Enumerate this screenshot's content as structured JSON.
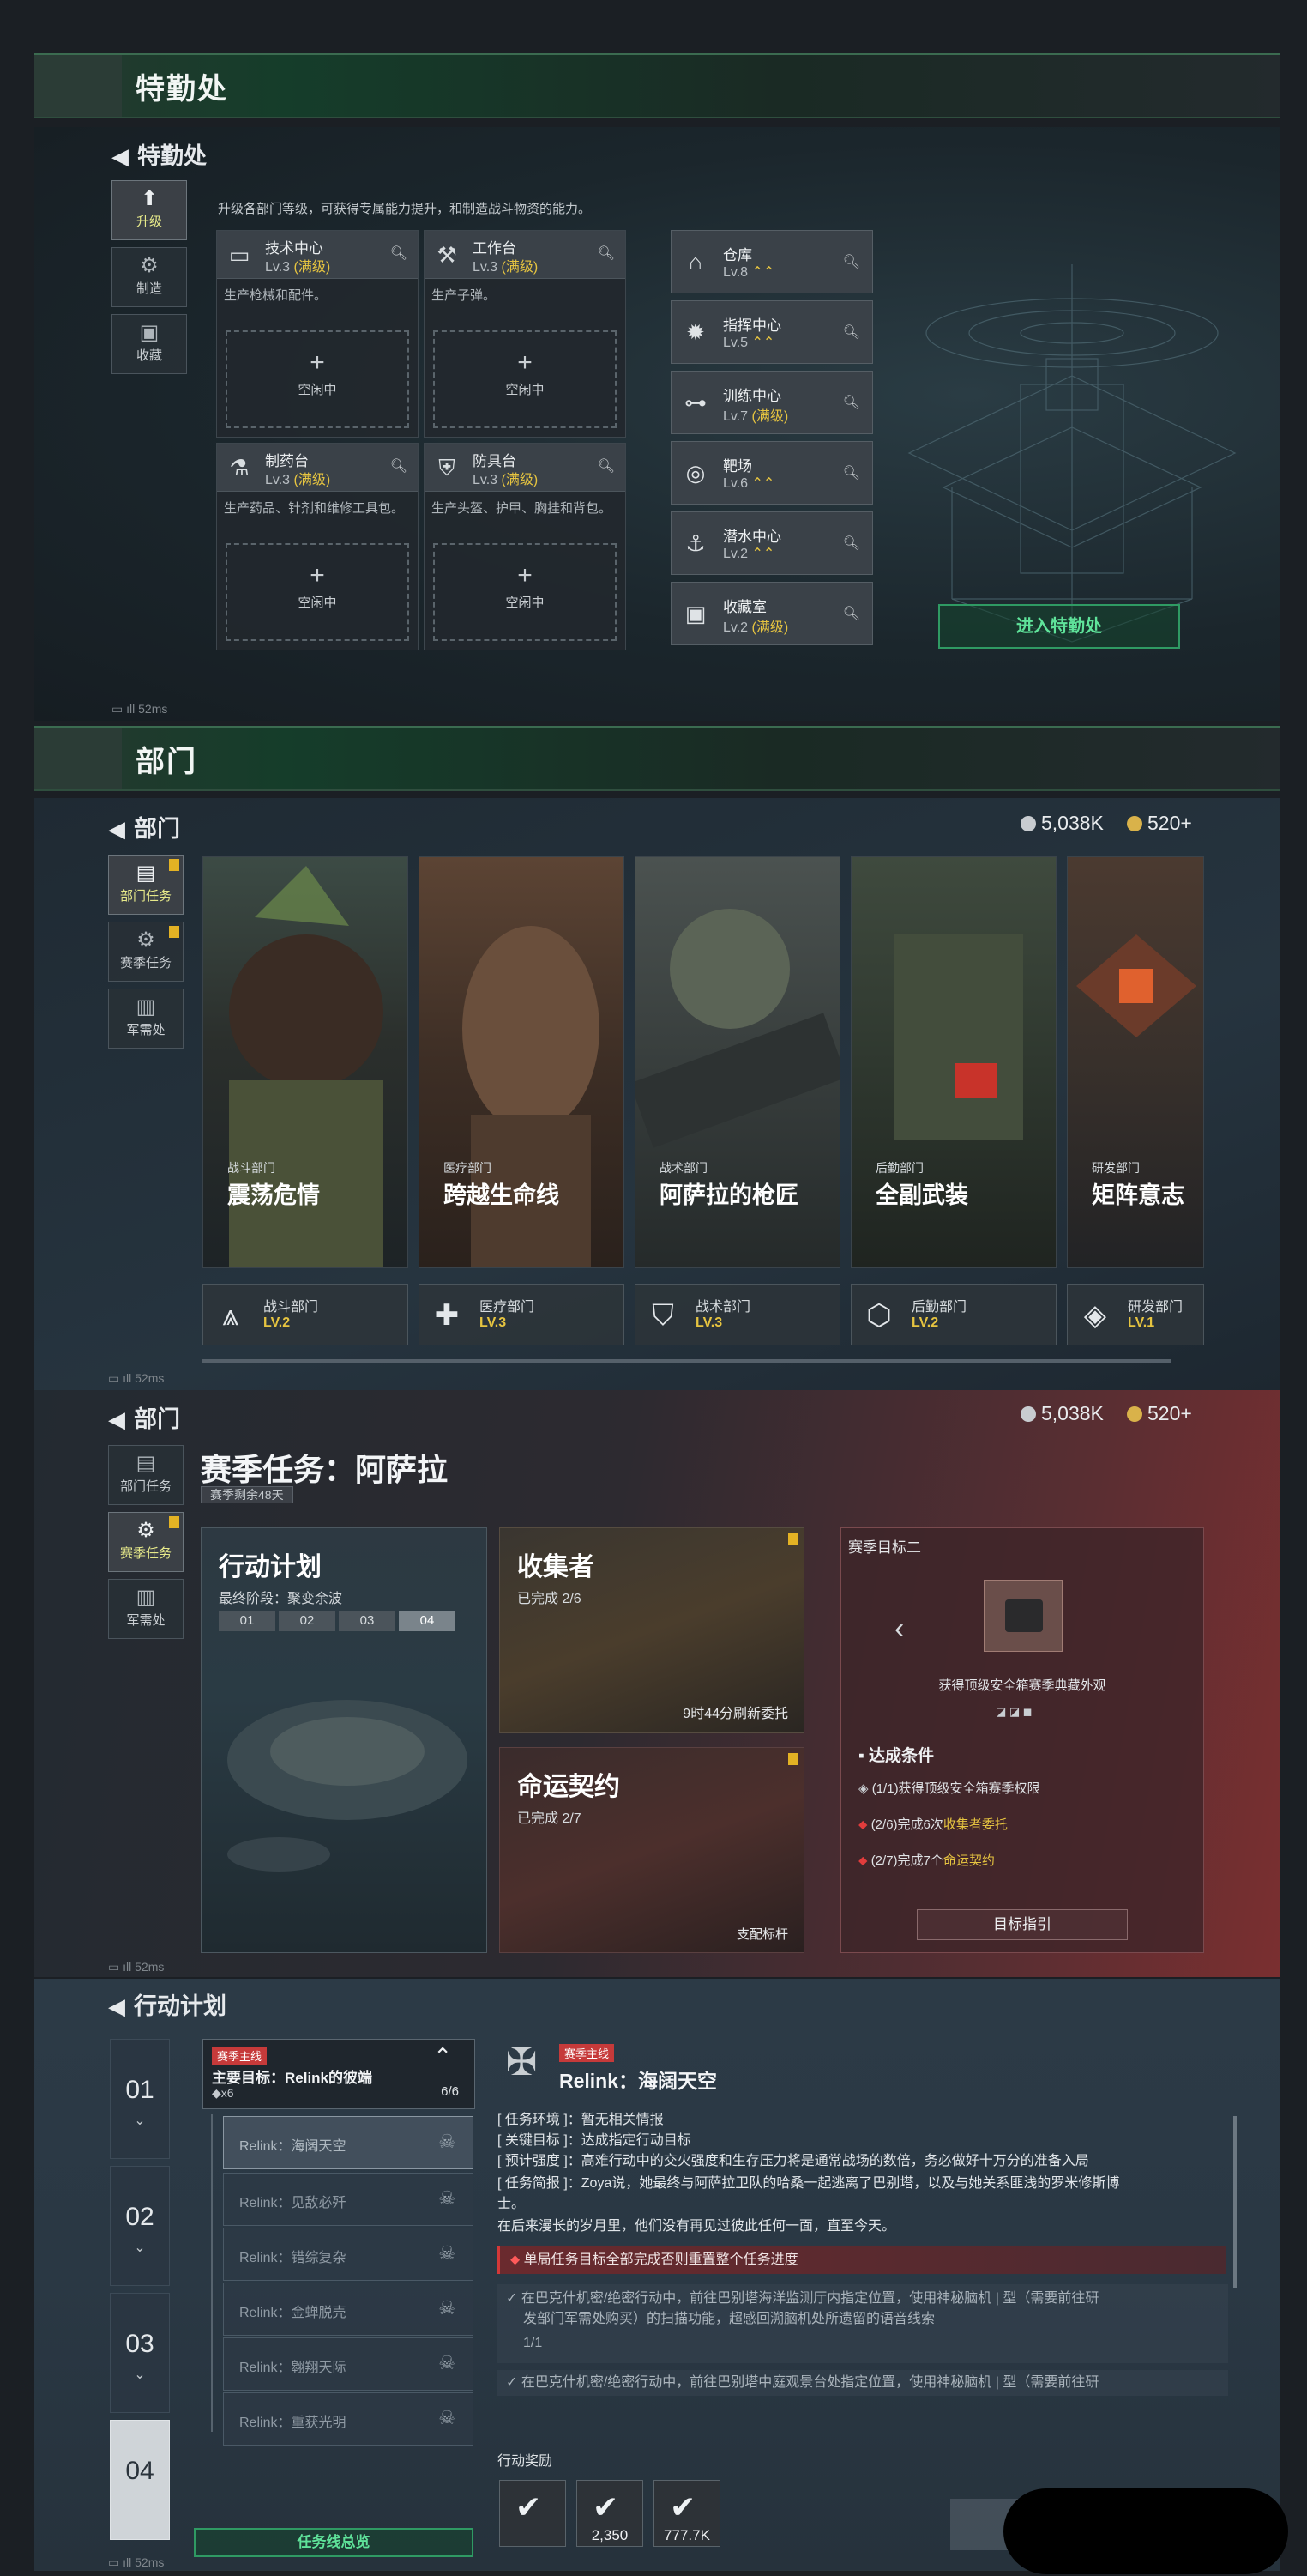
{
  "section1": {
    "banner": "特勤处",
    "back": "特勤处",
    "tabs": [
      "升级",
      "制造",
      "收藏"
    ],
    "description": "升级各部门等级，可获得专属能力提升，和制造战斗物资的能力。",
    "cards": [
      {
        "name": "技术中心",
        "level": "Lv.3",
        "max": "(满级)",
        "desc": "生产枪械和配件。",
        "slot": "空闲中"
      },
      {
        "name": "工作台",
        "level": "Lv.3",
        "max": "(满级)",
        "desc": "生产子弹。",
        "slot": "空闲中"
      },
      {
        "name": "制药台",
        "level": "Lv.3",
        "max": "(满级)",
        "desc": "生产药品、针剂和维修工具包。",
        "slot": "空闲中"
      },
      {
        "name": "防具台",
        "level": "Lv.3",
        "max": "(满级)",
        "desc": "生产头盔、护甲、胸挂和背包。",
        "slot": "空闲中"
      }
    ],
    "facilities": [
      {
        "name": "仓库",
        "level": "Lv.8",
        "suffix": "⌃⌃"
      },
      {
        "name": "指挥中心",
        "level": "Lv.5",
        "suffix": "⌃⌃"
      },
      {
        "name": "训练中心",
        "level": "Lv.7",
        "suffix": "(满级)"
      },
      {
        "name": "靶场",
        "level": "Lv.6",
        "suffix": "⌃⌃"
      },
      {
        "name": "潜水中心",
        "level": "Lv.2",
        "suffix": "⌃⌃"
      },
      {
        "name": "收藏室",
        "level": "Lv.2",
        "suffix": "(满级)"
      }
    ],
    "enter_button": "进入特勤处",
    "ping": "52ms"
  },
  "section2": {
    "banner": "部门",
    "back": "部门",
    "coins": "5,038K",
    "tickets": "520+",
    "tabs": [
      "部门任务",
      "赛季任务",
      "军需处"
    ],
    "departments": [
      {
        "sub": "战斗部门",
        "title": "震荡危情",
        "dept": "战斗部门",
        "level": "LV.2"
      },
      {
        "sub": "医疗部门",
        "title": "跨越生命线",
        "dept": "医疗部门",
        "level": "LV.3"
      },
      {
        "sub": "战术部门",
        "title": "阿萨拉的枪匠",
        "dept": "战术部门",
        "level": "LV.3"
      },
      {
        "sub": "后勤部门",
        "title": "全副武装",
        "dept": "后勤部门",
        "level": "LV.2"
      },
      {
        "sub": "研发部门",
        "title": "矩阵意志",
        "dept": "研发部门",
        "level": "LV.1"
      }
    ],
    "ping": "52ms"
  },
  "section3": {
    "back": "部门",
    "coins": "5,038K",
    "tickets": "520+",
    "tabs": [
      "部门任务",
      "赛季任务",
      "军需处"
    ],
    "title": "赛季任务：阿萨拉",
    "remaining": "赛季剩余48天",
    "plan": {
      "title": "行动计划",
      "stage_label": "最终阶段：聚变余波",
      "steps": [
        "01",
        "02",
        "03",
        "04"
      ]
    },
    "collector": {
      "title": "收集者",
      "progress": "已完成 2/6",
      "refresh": "9时44分刷新委托"
    },
    "fate": {
      "title": "命运契约",
      "progress": "已完成 2/7",
      "tag": "支配标杆"
    },
    "goal": {
      "header": "赛季目标二",
      "reward": "获得顶级安全箱赛季典藏外观",
      "cond_title": "达成条件",
      "conditions": [
        {
          "pre": "(1/1)获得顶级安全箱赛季权限",
          "hl": ""
        },
        {
          "pre": "(2/6)完成6次",
          "hl": "收集者委托"
        },
        {
          "pre": "(2/7)完成7个",
          "hl": "命运契约"
        }
      ],
      "button": "目标指引"
    },
    "ping": "52ms"
  },
  "section4": {
    "back": "行动计划",
    "rows": [
      "01",
      "02",
      "03",
      "04"
    ],
    "main_tag": "赛季主线",
    "main_goal": "主要目标：Relink的彼端",
    "main_count": "◆x6",
    "main_progress": "6/6",
    "subs": [
      "Relink：海阔天空",
      "Relink：见敌必歼",
      "Relink：错综复杂",
      "Relink：金蝉脱壳",
      "Relink：翱翔天际",
      "Relink：重获光明"
    ],
    "overview_button": "任务线总览",
    "detail": {
      "tag": "赛季主线",
      "title": "Relink：海阔天空",
      "env": "[ 任务环境 ]：暂无相关情报",
      "target": "[ 关键目标 ]：达成指定行动目标",
      "intensity": "[ 预计强度 ]：高难行动中的交火强度和生存压力将是通常战场的数倍，务必做好十万分的准备入局",
      "brief1": "[ 任务简报 ]：Zoya说，她最终与阿萨拉卫队的哈桑一起逃离了巴别塔，以及与她关系匪浅的罗米修斯博",
      "brief2": "士。",
      "brief3": "在后来漫长的岁月里，他们没有再见过彼此任何一面，直至今天。",
      "warning": "单局任务目标全部完成否则重置整个任务进度",
      "obj1_line1": "在巴克什机密/绝密行动中，前往巴别塔海洋监测厅内指定位置，使用神秘脑机 | 型（需要前往研",
      "obj1_line2": "发部门军需处购买）的扫描功能，超感回溯脑机处所遗留的语音线索",
      "obj1_progress": "1/1",
      "obj2_line1": "在巴克什机密/绝密行动中，前往巴别塔中庭观景台处指定位置，使用神秘脑机 | 型（需要前往研"
    },
    "rewards_label": "行动奖励",
    "rewards": [
      "",
      "2,350",
      "777.7K"
    ],
    "ping": "52ms"
  }
}
